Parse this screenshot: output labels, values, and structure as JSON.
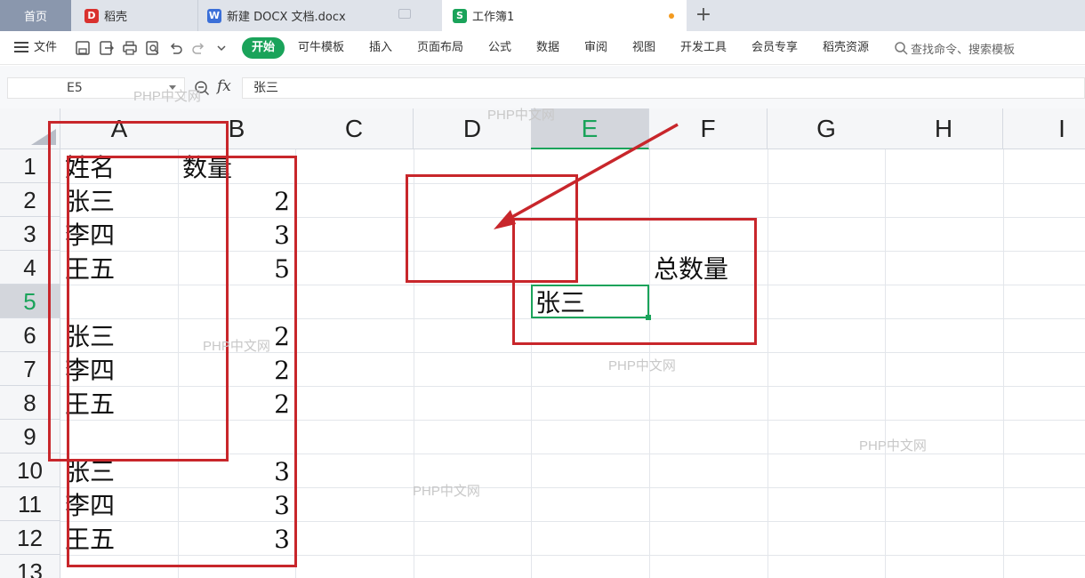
{
  "tabs": [
    {
      "label": "首页"
    },
    {
      "label": "稻壳",
      "icon": "daoke-icon",
      "icon_glyph": "D"
    },
    {
      "label": "新建 DOCX 文档.docx",
      "icon": "word-icon",
      "icon_glyph": "W"
    },
    {
      "label": "工作簿1",
      "icon": "sheet-icon",
      "icon_glyph": "S",
      "active": true
    }
  ],
  "new_tab": "+",
  "menu": {
    "file": "文件",
    "start": "开始",
    "items": [
      "可牛模板",
      "插入",
      "页面布局",
      "公式",
      "数据",
      "审阅",
      "视图",
      "开发工具",
      "会员专享",
      "稻壳资源"
    ],
    "search_placeholder": "查找命令、搜索模板"
  },
  "formula_bar": {
    "name_box": "E5",
    "fx": "fx",
    "content": "张三"
  },
  "columns": [
    "A",
    "B",
    "C",
    "D",
    "E",
    "F",
    "G",
    "H",
    "I"
  ],
  "active_column": "E",
  "rows": [
    "1",
    "2",
    "3",
    "4",
    "5",
    "6",
    "7",
    "8",
    "9",
    "10",
    "11",
    "12",
    "13"
  ],
  "active_row": "5",
  "cells": {
    "A1": "姓名",
    "B1": "数量",
    "A2": "张三",
    "B2": "2",
    "A3": "李四",
    "B3": "3",
    "A4": "王五",
    "B4": "5",
    "A6": "张三",
    "B6": "2",
    "A7": "李四",
    "B7": "2",
    "A8": "王五",
    "B8": "2",
    "A10": "张三",
    "B10": "3",
    "A11": "李四",
    "B11": "3",
    "A12": "王五",
    "B12": "3",
    "F4": "总数量",
    "E5": "张三"
  },
  "watermark": "PHP中文网",
  "annotation_color": "#c8262b",
  "accent_color": "#1aa35a"
}
